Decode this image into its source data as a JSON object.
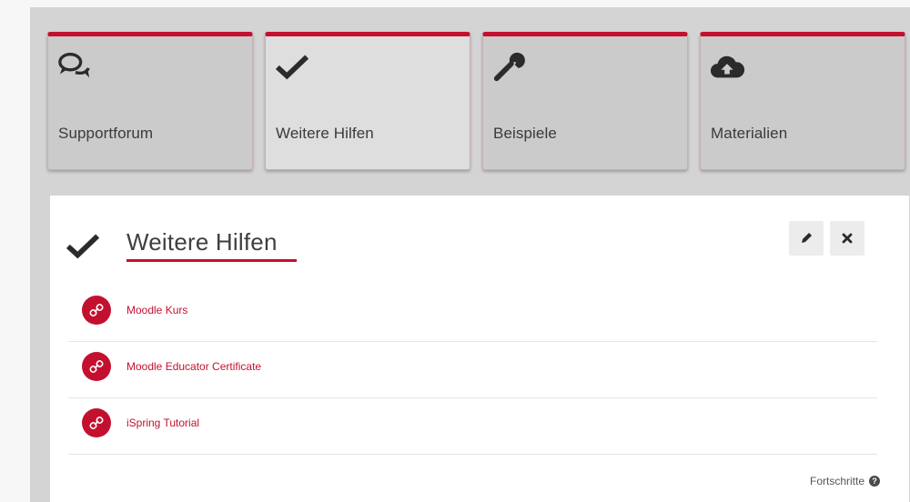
{
  "tiles": [
    {
      "label": "Supportforum",
      "icon": "comments-icon",
      "active": false
    },
    {
      "label": "Weitere Hilfen",
      "icon": "checkmark-icon",
      "active": true
    },
    {
      "label": "Beispiele",
      "icon": "wrench-icon",
      "active": false
    },
    {
      "label": "Materialien",
      "icon": "cloud-upload-icon",
      "active": false
    }
  ],
  "panel": {
    "title": "Weitere Hilfen",
    "title_icon": "checkmark-icon",
    "edit_icon": "pencil-icon",
    "close_icon": "close-icon",
    "links": [
      {
        "label": "Moodle Kurs",
        "icon": "link-icon"
      },
      {
        "label": "Moodle Educator Certificate",
        "icon": "link-icon"
      },
      {
        "label": "iSpring Tutorial",
        "icon": "link-icon"
      }
    ],
    "progress_label": "Fortschritte",
    "progress_icon": "help-icon"
  },
  "colors": {
    "accent": "#c4102f",
    "tile_bg": "#cbcbcb",
    "tile_active_bg": "#dedede",
    "frame_bg": "#d4d4d4"
  }
}
